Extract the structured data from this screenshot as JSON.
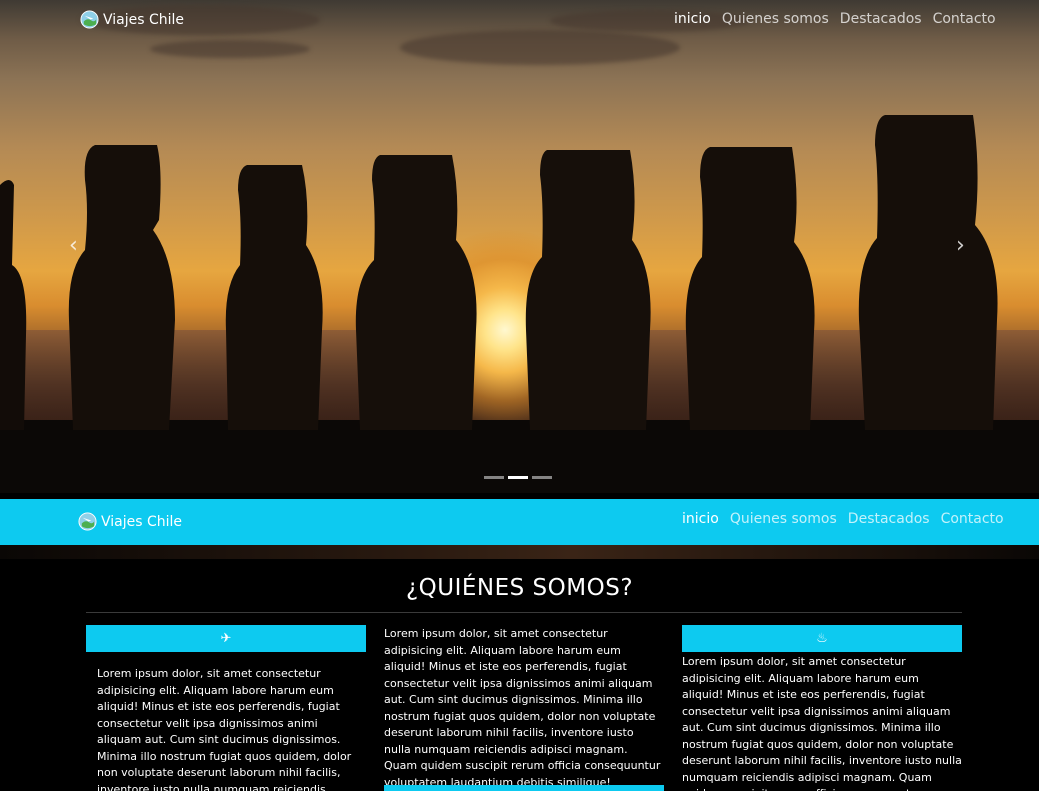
{
  "brand": {
    "name": "Viajes Chile",
    "logo_icon": "globe-travel-icon"
  },
  "nav": {
    "items": [
      {
        "label": "inicio",
        "active": true
      },
      {
        "label": "Quienes somos",
        "active": false
      },
      {
        "label": "Destacados",
        "active": false
      },
      {
        "label": "Contacto",
        "active": false
      }
    ]
  },
  "carousel": {
    "prev_icon": "chevron-left-icon",
    "next_icon": "chevron-right-icon",
    "prev_glyph": "‹",
    "next_glyph": "›",
    "slide_count": 3,
    "active_slide": 2
  },
  "about": {
    "title": "¿QUIÉNES SOMOS?",
    "col1_icon": "airplane-icon",
    "col1_icon_glyph": "✈",
    "col1_text": "Lorem ipsum dolor, sit amet consectetur adipisicing elit. Aliquam labore harum eum aliquid! Minus et iste eos perferendis, fugiat consectetur velit ipsa dignissimos animi aliquam aut. Cum sint ducimus dignissimos. Minima illo nostrum fugiat quos quidem, dolor non voluptate deserunt laborum nihil facilis, inventore iusto nulla numquam reiciendis adipisci magnam. Quam quidem suscipit rerum",
    "col2_text": "Lorem ipsum dolor, sit amet consectetur adipisicing elit. Aliquam labore harum eum aliquid! Minus et iste eos perferendis, fugiat consectetur velit ipsa dignissimos animi aliquam aut. Cum sint ducimus dignissimos. Minima illo nostrum fugiat quos quidem, dolor non voluptate deserunt laborum nihil facilis, inventore iusto nulla numquam reiciendis adipisci magnam. Quam quidem suscipit rerum officia consequuntur voluptatem laudantium debitis similique!",
    "col3_icon": "pool-icon",
    "col3_icon_glyph": "♨",
    "col3_text": "Lorem ipsum dolor, sit amet consectetur adipisicing elit. Aliquam labore harum eum aliquid! Minus et iste eos perferendis, fugiat consectetur velit ipsa dignissimos animi aliquam aut. Cum sint ducimus dignissimos. Minima illo nostrum fugiat quos quidem, dolor non voluptate deserunt laborum nihil facilis, inventore iusto nulla numquam reiciendis adipisci magnam. Quam quidem suscipit rerum officia consequuntur voluptatem"
  },
  "colors": {
    "accent": "#0dcaf0",
    "background": "#000000"
  }
}
